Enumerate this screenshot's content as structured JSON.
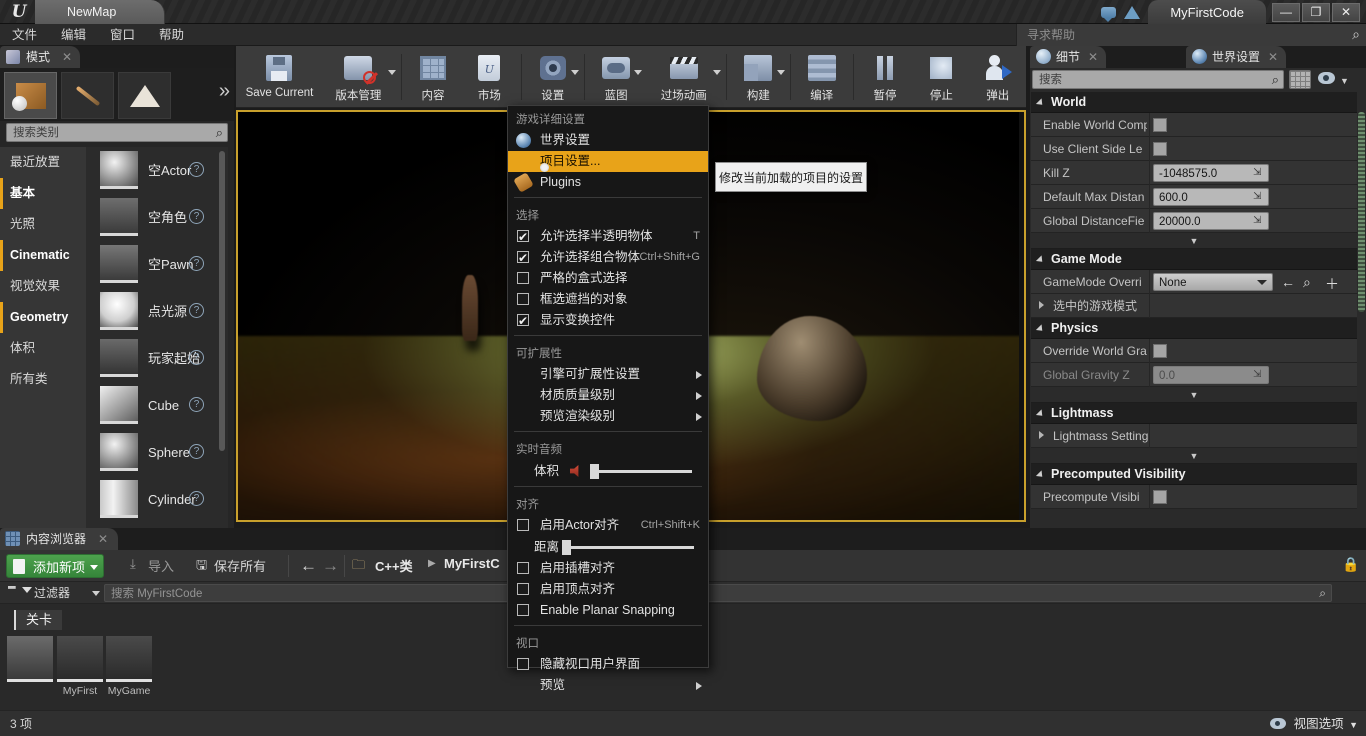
{
  "titlebar": {
    "map_tab": "NewMap",
    "project_tab": "MyFirstCode",
    "minimize": "—",
    "restore": "❐",
    "close": "✕",
    "chat_icon": "chat-icon",
    "marketplace_icon": "gem-icon"
  },
  "menubar": {
    "items": [
      "文件",
      "编辑",
      "窗口",
      "帮助"
    ],
    "help_search_placeholder": "寻求帮助"
  },
  "toolbar": {
    "buttons": [
      {
        "label": "Save Current",
        "icon": "save-icon",
        "dropdown": false
      },
      {
        "label": "版本管理",
        "icon": "source-control-icon",
        "dropdown": true
      },
      {
        "label": "内容",
        "icon": "content-icon",
        "dropdown": false
      },
      {
        "label": "市场",
        "icon": "marketplace-bag-icon",
        "dropdown": false
      },
      {
        "label": "设置",
        "icon": "gear-icon",
        "dropdown": true
      },
      {
        "label": "蓝图",
        "icon": "blueprint-icon",
        "dropdown": true
      },
      {
        "label": "过场动画",
        "icon": "cinematics-icon",
        "dropdown": true
      },
      {
        "label": "构建",
        "icon": "build-icon",
        "dropdown": true
      },
      {
        "label": "编译",
        "icon": "compile-icon",
        "dropdown": false
      },
      {
        "label": "暂停",
        "icon": "pause-icon",
        "dropdown": false
      },
      {
        "label": "停止",
        "icon": "stop-icon",
        "dropdown": false
      },
      {
        "label": "弹出",
        "icon": "eject-icon",
        "dropdown": false
      }
    ]
  },
  "modes_panel": {
    "tab_label": "模式",
    "tab_icon": "modes-icon",
    "close_label": "✕",
    "mode_buttons": [
      "place-mode-icon",
      "paint-mode-icon",
      "landscape-mode-icon"
    ],
    "more_modes": "»",
    "search_placeholder": "搜索类别",
    "categories": [
      {
        "label": "最近放置",
        "active": false
      },
      {
        "label": "基本",
        "active": true
      },
      {
        "label": "光照",
        "active": false
      },
      {
        "label": "Cinematic",
        "active": false
      },
      {
        "label": "视觉效果",
        "active": false
      },
      {
        "label": "Geometry",
        "active": false
      },
      {
        "label": "体积",
        "active": false
      },
      {
        "label": "所有类",
        "active": false
      }
    ],
    "placeables": [
      {
        "label": "空Actor",
        "thumb": "sphere-thumb"
      },
      {
        "label": "空角色",
        "thumb": "character-thumb"
      },
      {
        "label": "空Pawn",
        "thumb": "pawn-thumb"
      },
      {
        "label": "点光源",
        "thumb": "pointlight-thumb"
      },
      {
        "label": "玩家起始",
        "thumb": "playerstart-thumb"
      },
      {
        "label": "Cube",
        "thumb": "cube-thumb"
      },
      {
        "label": "Sphere",
        "thumb": "sphere-thumb"
      },
      {
        "label": "Cylinder",
        "thumb": "cylinder-thumb"
      }
    ],
    "help_glyph": "?"
  },
  "settings_menu": {
    "sections": [
      {
        "title": "游戏详细设置",
        "items": [
          {
            "label": "世界设置",
            "icon": "globe-icon",
            "type": "icon",
            "highlighted": false
          },
          {
            "label": "项目设置...",
            "icon": "project-settings-icon",
            "type": "icon",
            "highlighted": true
          },
          {
            "label": "Plugins",
            "icon": "plugin-icon",
            "type": "icon",
            "highlighted": false
          }
        ]
      },
      {
        "title": "选择",
        "items": [
          {
            "label": "允许选择半透明物体",
            "type": "check",
            "checked": true,
            "shortcut": "T"
          },
          {
            "label": "允许选择组合物体",
            "type": "check",
            "checked": true,
            "shortcut": "Ctrl+Shift+G"
          },
          {
            "label": "严格的盒式选择",
            "type": "check",
            "checked": false,
            "shortcut": ""
          },
          {
            "label": "框选遮挡的对象",
            "type": "check",
            "checked": false,
            "shortcut": ""
          },
          {
            "label": "显示变换控件",
            "type": "check",
            "checked": true,
            "shortcut": ""
          }
        ]
      },
      {
        "title": "可扩展性",
        "items": [
          {
            "label": "引擎可扩展性设置",
            "type": "submenu"
          },
          {
            "label": "材质质量级别",
            "type": "submenu"
          },
          {
            "label": "预览渲染级别",
            "type": "submenu"
          }
        ]
      },
      {
        "title": "实时音频",
        "items": [
          {
            "label": "体积",
            "type": "slider",
            "icon": "speaker-muted-icon",
            "value": 0
          }
        ]
      },
      {
        "title": "对齐",
        "items": [
          {
            "label": "启用Actor对齐",
            "type": "check",
            "checked": false,
            "shortcut": "Ctrl+Shift+K"
          },
          {
            "label": "距离",
            "type": "slider",
            "value": 0
          },
          {
            "label": "启用插槽对齐",
            "type": "check",
            "checked": false,
            "shortcut": ""
          },
          {
            "label": "启用顶点对齐",
            "type": "check",
            "checked": false,
            "shortcut": ""
          },
          {
            "label": "Enable Planar Snapping",
            "type": "check",
            "checked": false,
            "shortcut": ""
          }
        ]
      },
      {
        "title": "视口",
        "items": [
          {
            "label": "隐藏视口用户界面",
            "type": "check",
            "checked": false,
            "shortcut": ""
          },
          {
            "label": "预览",
            "type": "submenu"
          }
        ]
      }
    ]
  },
  "tooltip": {
    "text": "修改当前加载的项目的设置"
  },
  "details_panel": {
    "tabs": [
      {
        "label": "细节",
        "icon": "details-icon",
        "close": "✕",
        "active": false
      },
      {
        "label": "世界设置",
        "icon": "globe-icon",
        "close": "✕",
        "active": true
      }
    ],
    "search_placeholder": "搜索",
    "grid_icon": "grid-view-icon",
    "eye_icon": "eye-icon",
    "sections": [
      {
        "title": "World",
        "rows": [
          {
            "label": "Enable World Comp",
            "type": "checkbox",
            "checked": false
          },
          {
            "label": "Use Client Side Le",
            "type": "checkbox",
            "checked": false
          },
          {
            "label": "Kill Z",
            "type": "number",
            "value": "-1048575.0"
          },
          {
            "label": "Default Max Distan",
            "type": "number",
            "value": "600.0"
          },
          {
            "label": "Global DistanceFie",
            "type": "number",
            "value": "20000.0"
          }
        ],
        "has_more": true
      },
      {
        "title": "Game Mode",
        "rows": [
          {
            "label": "GameMode Overri",
            "type": "combo",
            "value": "None",
            "buttons": [
              "back-arrow-icon",
              "browse-icon",
              "plus-icon"
            ]
          },
          {
            "label": "选中的游戏模式",
            "type": "expander",
            "value": ""
          }
        ],
        "has_more": false
      },
      {
        "title": "Physics",
        "rows": [
          {
            "label": "Override World Gra",
            "type": "checkbox",
            "checked": false
          },
          {
            "label": "Global Gravity Z",
            "type": "number",
            "value": "0.0",
            "disabled": true
          }
        ],
        "has_more": true
      },
      {
        "title": "Lightmass",
        "rows": [
          {
            "label": "Lightmass Setting",
            "type": "expander",
            "value": ""
          }
        ],
        "has_more": true
      },
      {
        "title": "Precomputed Visibility",
        "rows": [
          {
            "label": "Precompute Visibi",
            "type": "checkbox",
            "checked": false
          }
        ],
        "has_more": false
      }
    ]
  },
  "content_browser": {
    "tab_label": "内容浏览器",
    "tab_icon": "content-browser-icon",
    "close_label": "✕",
    "add_new_label": "添加新项",
    "import_label": "导入",
    "save_all_label": "保存所有",
    "back_arrow": "←",
    "forward_arrow": "→",
    "breadcrumb": [
      "C++类",
      "MyFirstC"
    ],
    "breadcrumb_sep": "▶",
    "folder_icon": "folder-icon",
    "filters_label": "过滤器",
    "search_placeholder": "搜索 MyFirstCode",
    "current_folder": "关卡",
    "assets": [
      {
        "name": "",
        "thumb": "character-asset-thumb"
      },
      {
        "name": "MyFirst",
        "thumb": "gamemode-asset-thumb"
      },
      {
        "name": "MyGame",
        "thumb": "gamemode-asset-thumb"
      }
    ],
    "status_count": "3 项",
    "view_options_label": "视图选项"
  }
}
